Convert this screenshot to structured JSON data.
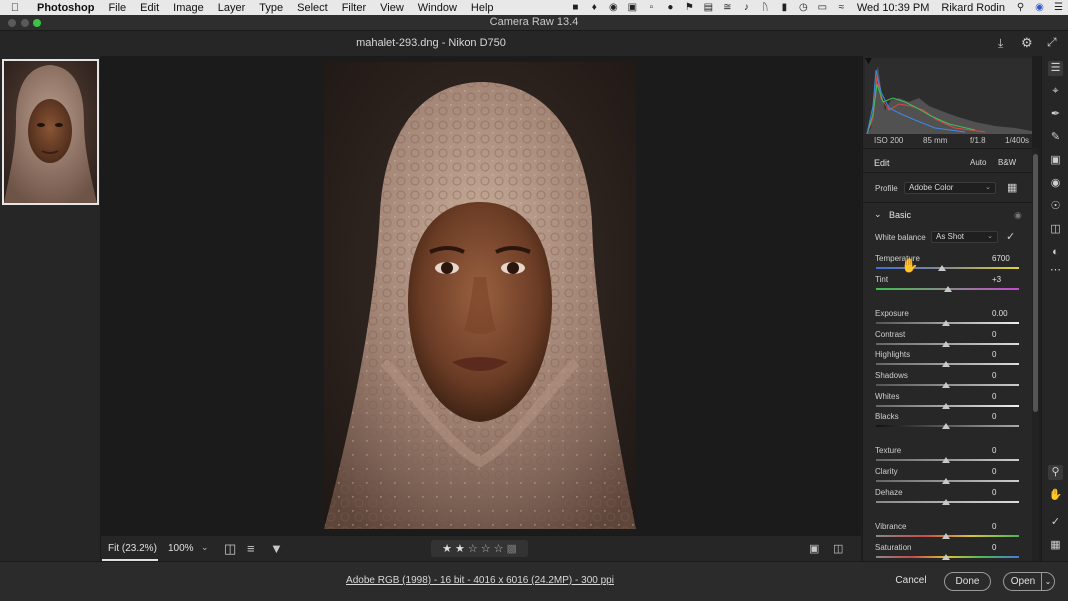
{
  "menubar": {
    "app": "Photoshop",
    "items": [
      "File",
      "Edit",
      "Image",
      "Layer",
      "Type",
      "Select",
      "Filter",
      "View",
      "Window",
      "Help"
    ],
    "clock": "Wed 10:39 PM",
    "user": "Rikard Rodin"
  },
  "window": {
    "title": "Camera Raw 13.4",
    "file_title": "mahalet-293.dng  -  Nikon D750"
  },
  "view": {
    "fit_label": "Fit (23.2%)",
    "zoom_label": "100%"
  },
  "exif": {
    "iso": "ISO 200",
    "focal": "85 mm",
    "aperture": "f/1.8",
    "shutter": "1/400s"
  },
  "edit": {
    "title": "Edit",
    "auto": "Auto",
    "bw": "B&W",
    "profile_label": "Profile",
    "profile_value": "Adobe Color"
  },
  "basic": {
    "title": "Basic",
    "wb_label": "White balance",
    "wb_value": "As Shot",
    "sliders": [
      {
        "label": "Temperature",
        "value": "6700"
      },
      {
        "label": "Tint",
        "value": "+3"
      },
      {
        "label": "Exposure",
        "value": "0.00"
      },
      {
        "label": "Contrast",
        "value": "0"
      },
      {
        "label": "Highlights",
        "value": "0"
      },
      {
        "label": "Shadows",
        "value": "0"
      },
      {
        "label": "Whites",
        "value": "0"
      },
      {
        "label": "Blacks",
        "value": "0"
      },
      {
        "label": "Texture",
        "value": "0"
      },
      {
        "label": "Clarity",
        "value": "0"
      },
      {
        "label": "Dehaze",
        "value": "0"
      },
      {
        "label": "Vibrance",
        "value": "0"
      },
      {
        "label": "Saturation",
        "value": "0"
      }
    ]
  },
  "footer": {
    "info": "Adobe RGB (1998) - 16 bit - 4016 x 6016 (24.2MP) - 300 ppi",
    "cancel": "Cancel",
    "done": "Done",
    "open": "Open"
  },
  "colors": {
    "panel": "#272727",
    "canvas": "#1b1b1b",
    "accent_blue": "#2a72d6"
  }
}
